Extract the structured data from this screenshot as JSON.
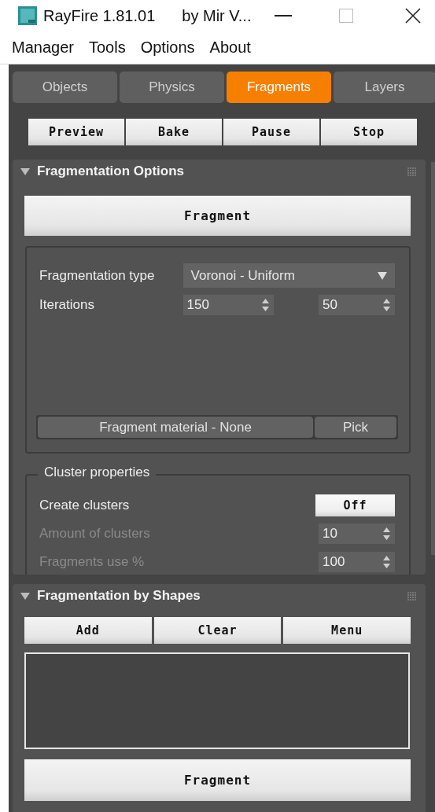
{
  "window": {
    "title": "RayFire 1.81.01",
    "subtitle": "by Mir V..."
  },
  "menu": [
    "Manager",
    "Tools",
    "Options",
    "About"
  ],
  "tabs": [
    {
      "label": "Objects",
      "selected": false
    },
    {
      "label": "Physics",
      "selected": false
    },
    {
      "label": "Fragments",
      "selected": true
    },
    {
      "label": "Layers",
      "selected": false
    }
  ],
  "toolbar": [
    "Preview",
    "Bake",
    "Pause",
    "Stop"
  ],
  "rollouts": [
    {
      "kind": "options",
      "title": "Fragmentation Options",
      "expanded": true,
      "fragment_button": "Fragment",
      "fields": [
        {
          "kind": "dropdown",
          "label": "Fragmentation type",
          "value": "Voronoi - Uniform"
        },
        {
          "kind": "spinners",
          "label": "Iterations",
          "values": [
            "150",
            "50"
          ]
        }
      ],
      "material": {
        "label": "Fragment material - None",
        "pick": "Pick"
      },
      "cluster": {
        "title": "Cluster properties",
        "rows": [
          {
            "kind": "toggle",
            "label": "Create clusters",
            "value": "Off",
            "disabled": false
          },
          {
            "kind": "spinner",
            "label": "Amount of clusters",
            "value": "10",
            "disabled": true
          },
          {
            "kind": "spinner",
            "label": "Fragments use %",
            "value": "100",
            "disabled": true
          }
        ]
      }
    },
    {
      "kind": "shapes",
      "title": "Fragmentation by Shapes",
      "expanded": true,
      "buttons": [
        "Add",
        "Clear",
        "Menu"
      ],
      "fragment_button": "Fragment"
    }
  ]
}
